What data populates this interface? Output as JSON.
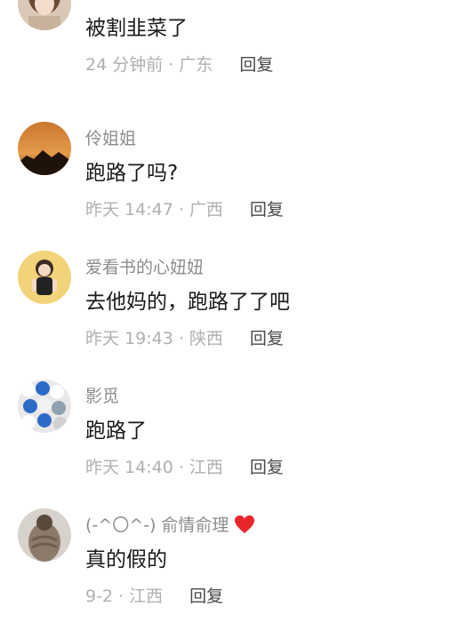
{
  "comments": [
    {
      "username": "",
      "text": "被割韭菜了",
      "meta": "24 分钟前 · 广东",
      "reply_label": "回复"
    },
    {
      "username": "伶姐姐",
      "text": "跑路了吗?",
      "meta": "昨天 14:47 · 广西",
      "reply_label": "回复"
    },
    {
      "username": "爱看书的心妞妞",
      "text": "去他妈的，跑路了了吧",
      "meta": "昨天 19:43 · 陕西",
      "reply_label": "回复"
    },
    {
      "username": "影觅",
      "text": "跑路了",
      "meta": "昨天 14:40 · 江西",
      "reply_label": "回复"
    },
    {
      "username": "(-^〇^-) 俞情俞理",
      "text": "真的假的",
      "meta": "9-2 · 江西",
      "reply_label": "回复",
      "badge_icon": "red-heart-icon"
    }
  ],
  "colors": {
    "username": "#8c8c8c",
    "body": "#1a1a1a",
    "meta": "#b0b0b0",
    "reply": "#4a4a4a",
    "heart": "#e8262d"
  }
}
